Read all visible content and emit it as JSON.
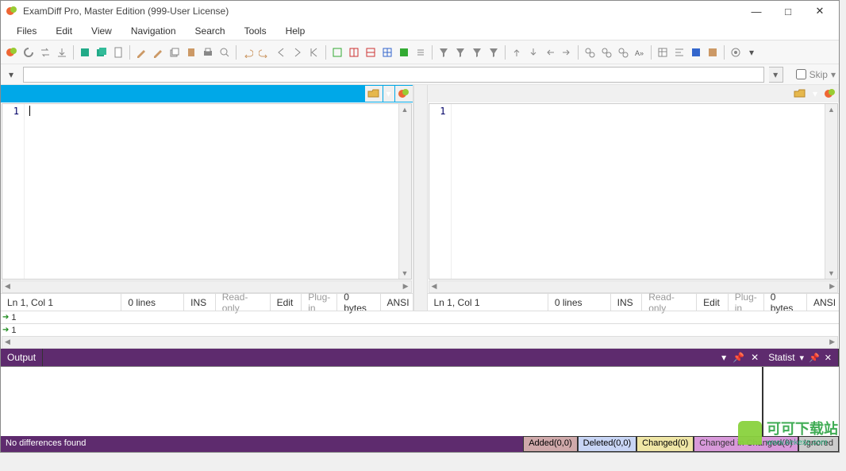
{
  "titlebar": {
    "title": "ExamDiff Pro, Master Edition (999-User License)"
  },
  "menu": {
    "items": [
      "Files",
      "Edit",
      "View",
      "Navigation",
      "Search",
      "Tools",
      "Help"
    ]
  },
  "addrbar": {
    "skip_label": "Skip"
  },
  "pane_left": {
    "line1": "1",
    "status": {
      "pos": "Ln 1, Col 1",
      "lines": "0 lines",
      "ins": "INS",
      "readonly": "Read-only",
      "edit": "Edit",
      "plugin": "Plug-in",
      "bytes": "0 bytes",
      "enc": "ANSI"
    }
  },
  "pane_right": {
    "line1": "1",
    "status": {
      "pos": "Ln 1, Col 1",
      "lines": "0 lines",
      "ins": "INS",
      "readonly": "Read-only",
      "edit": "Edit",
      "plugin": "Plug-in",
      "bytes": "0 bytes",
      "enc": "ANSI"
    }
  },
  "bookmarks": [
    "1",
    "1"
  ],
  "panels": {
    "output_label": "Output",
    "statist_label": "Statist"
  },
  "statusbar": {
    "message": "No differences found",
    "added": "Added(0,0)",
    "deleted": "Deleted(0,0)",
    "changed": "Changed(0)",
    "changed_in_changed": "Changed in Changed(0)",
    "ignored": "Ignored"
  },
  "watermark": {
    "text": "可可下载站",
    "sub": "www.kekexz.com"
  }
}
